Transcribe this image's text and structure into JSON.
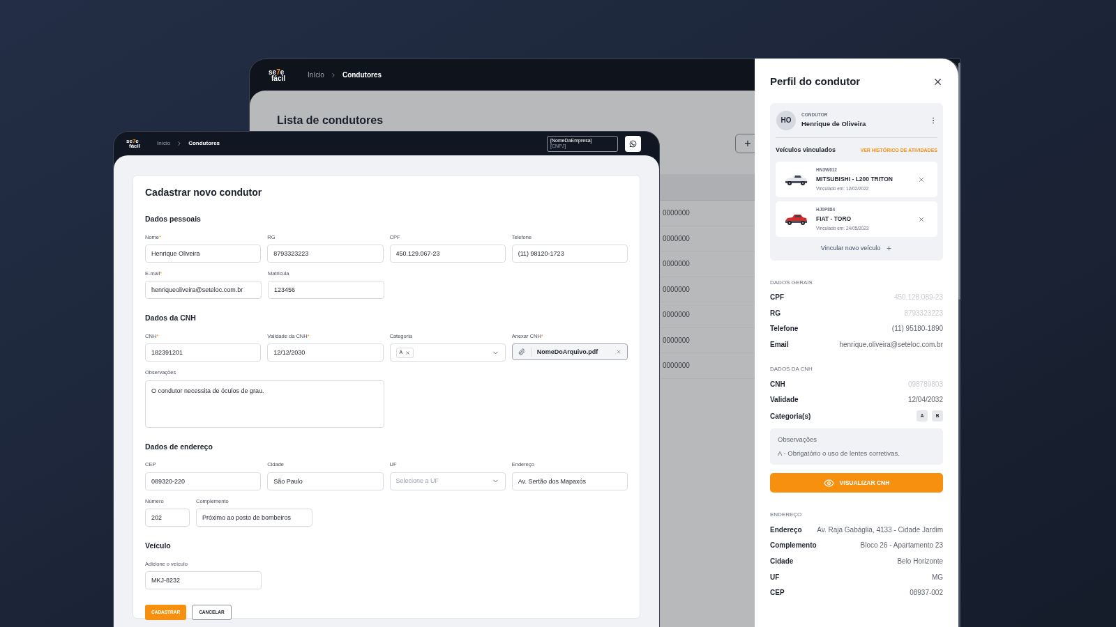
{
  "back_window": {
    "logo": {
      "before": "se",
      "accent": "7",
      "after": "e",
      "second_line": "fácil"
    },
    "breadcrumb": [
      {
        "label": "Início",
        "selected": false
      },
      {
        "label": "Condutores",
        "selected": true
      }
    ],
    "title": "Lista de condutores",
    "add_button": "+",
    "rows": [
      {
        "cell": "0000000"
      },
      {
        "cell": "0000000"
      },
      {
        "cell": "0000000"
      },
      {
        "cell": "0000000"
      },
      {
        "cell": "0000000"
      },
      {
        "cell": "0000000"
      },
      {
        "cell": "0000000"
      }
    ]
  },
  "form_window": {
    "logo": {
      "before": "se",
      "accent": "7",
      "after": "e",
      "second_line": "fácil"
    },
    "breadcrumb": [
      {
        "label": "Início",
        "selected": false
      },
      {
        "label": "Condutores",
        "selected": true
      }
    ],
    "company": {
      "name": "[NomeDaEmpresa]",
      "cnpj": "[CNPJ]"
    },
    "form": {
      "title": "Cadastrar novo condutor",
      "sections": [
        {
          "title": "Dados pessoais",
          "rows": [
            [
              {
                "kind": "text",
                "label": "Nome",
                "required_mark": "*",
                "value": "Henrique Oliveira"
              },
              {
                "kind": "text",
                "label": "RG",
                "value": "8793323223"
              },
              {
                "kind": "text",
                "label": "CPF",
                "value": "450.129.067-23"
              },
              {
                "kind": "text",
                "label": "Telefone",
                "value": "(11) 98120-1723"
              }
            ],
            [
              {
                "kind": "text",
                "label": "E-mail",
                "required_mark": "*",
                "value": "henriqueoliveira@seteloc.com.br"
              },
              {
                "kind": "text",
                "label": "Matricula",
                "value": "123456"
              }
            ]
          ]
        },
        {
          "title": "Dados da CNH",
          "rows": [
            [
              {
                "kind": "text",
                "label": "CNH",
                "required_mark": "*",
                "value": "182391201"
              },
              {
                "kind": "text",
                "label": "Validade da CNH",
                "required_mark": "*",
                "value": "12/12/2030"
              },
              {
                "kind": "select",
                "label": "Categoria",
                "chips": [
                  "A"
                ]
              },
              {
                "kind": "file",
                "label": "Anexar CNH",
                "required_mark": "*",
                "value": "NomeDoArquivo.pdf"
              }
            ],
            [
              {
                "kind": "textarea",
                "label": "Observações",
                "value": "O condutor necessita de óculos de grau."
              }
            ]
          ]
        },
        {
          "title": "Dados de endereço",
          "rows": [
            [
              {
                "kind": "text",
                "label": "CEP",
                "value": "089320-220"
              },
              {
                "kind": "text",
                "label": "Cidade",
                "value": "São Paulo"
              },
              {
                "kind": "select",
                "label": "UF",
                "placeholder": "Selecione a UF"
              },
              {
                "kind": "text",
                "label": "Endereço",
                "value": "Av. Sertão dos Mapaxós"
              }
            ],
            [
              {
                "kind": "short",
                "label": "Número",
                "value": "202"
              },
              {
                "kind": "text",
                "label": "Complemento",
                "value": "Próximo ao posto de bombeiros"
              }
            ]
          ]
        },
        {
          "title": "Veículo",
          "rows": [
            [
              {
                "kind": "text",
                "label": "Adicione o veículo",
                "value": "MKJ-8232"
              }
            ]
          ]
        }
      ],
      "buttons": [
        {
          "kind": "primary",
          "label": "CADASTRAR"
        },
        {
          "kind": "secondary",
          "label": "CANCELAR"
        }
      ]
    }
  },
  "drawer": {
    "title": "Perfil do condutor",
    "driver": {
      "initials": "HO",
      "role": "CONDUTOR",
      "name": "Henrique de Oliveira"
    },
    "vehicles_title": "Veículos vinculados",
    "history_link": "VER HISTÓRICO DE ATIVIDADES",
    "vehicles": [
      {
        "plate": "HN3W612",
        "model": "MITSUBISHI - L200 TRITON",
        "linked": "Vinculado em: 12/02/2022"
      },
      {
        "plate": "HJ0P884",
        "model": "FIAT - TORO",
        "linked": "Vinculado em: 24/05/2023"
      }
    ],
    "link_vehicle": "Vincular novo veículo",
    "general": {
      "title": "DADOS GERAIS",
      "rows": [
        {
          "label": "CPF",
          "value": "450.128.089-23",
          "muted": true
        },
        {
          "label": "RG",
          "value": "8793323223",
          "muted": true
        },
        {
          "label": "Telefone",
          "value": "(11) 95180-1890",
          "muted": false
        },
        {
          "label": "Email",
          "value": "henrique.oliveira@seteloc.com.br",
          "muted": false
        }
      ]
    },
    "cnh": {
      "title": "DADOS DA CNH",
      "rows": [
        {
          "label": "CNH",
          "value": "098789803",
          "muted": true
        },
        {
          "label": "Validade",
          "value": "12/04/2032",
          "muted": false
        }
      ],
      "categories": {
        "label": "Categoria(s)",
        "chips": [
          "A",
          "B"
        ]
      },
      "observations": {
        "title": "Observações",
        "text": "A - Obrigatório o uso de lentes corretivas."
      },
      "action": "VISUALIZAR CNH"
    },
    "address": {
      "title": "ENDEREÇO",
      "rows": [
        {
          "label": "Endereço",
          "value": "Av. Raja Gabáglia, 4133 - Cidade Jardim",
          "muted": false
        },
        {
          "label": "Complemento",
          "value": "Bloco 26 - Apartamento 23",
          "muted": false
        },
        {
          "label": "Cidade",
          "value": "Belo Horizonte",
          "muted": false
        },
        {
          "label": "UF",
          "value": "MG",
          "muted": false
        },
        {
          "label": "CEP",
          "value": "08937-002",
          "muted": false
        }
      ]
    }
  }
}
